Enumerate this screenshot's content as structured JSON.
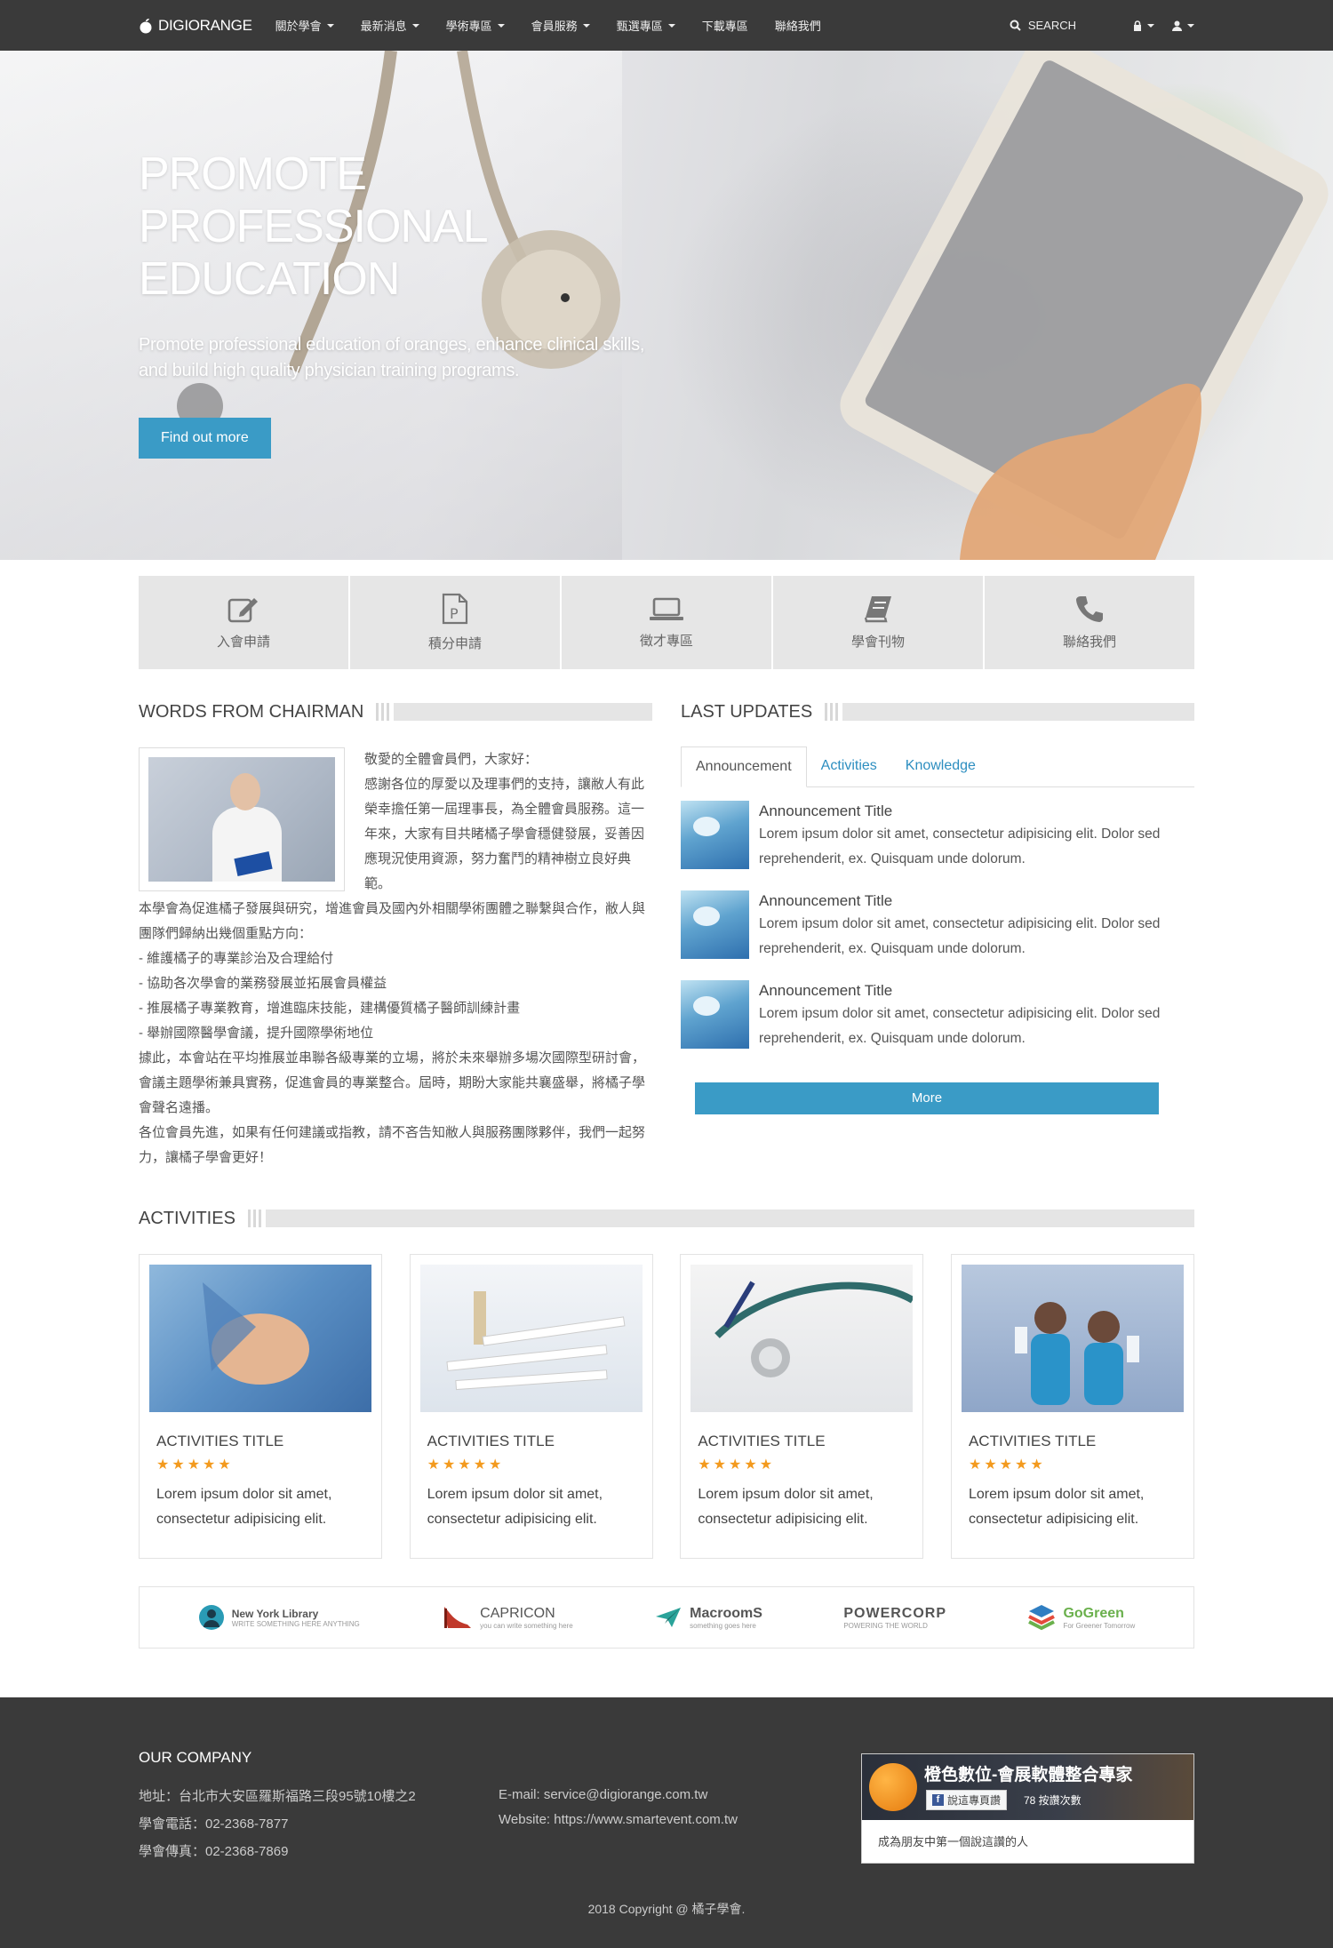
{
  "nav": {
    "brand": "DIGIORANGE",
    "items": [
      {
        "label": "關於學會",
        "dropdown": true
      },
      {
        "label": "最新消息",
        "dropdown": true
      },
      {
        "label": "學術專區",
        "dropdown": true
      },
      {
        "label": "會員服務",
        "dropdown": true
      },
      {
        "label": "甄選專區",
        "dropdown": true
      },
      {
        "label": "下載專區",
        "dropdown": false
      },
      {
        "label": "聯絡我們",
        "dropdown": false
      }
    ],
    "search": "SEARCH"
  },
  "hero": {
    "title_lines": [
      "PROMOTE",
      "PROFESSIONAL",
      "EDUCATION"
    ],
    "subtitle": "Promote professional education of oranges, enhance clinical skills, and build high quality physician training programs.",
    "button": "Find out more",
    "slide_count": 3,
    "active_slide": 2
  },
  "features": [
    {
      "label": "入會申請",
      "icon": "edit-icon"
    },
    {
      "label": "積分申請",
      "icon": "document-p-icon"
    },
    {
      "label": "徵才專區",
      "icon": "laptop-icon"
    },
    {
      "label": "學會刊物",
      "icon": "book-icon"
    },
    {
      "label": "聯絡我們",
      "icon": "phone-icon"
    }
  ],
  "chairman": {
    "heading": "WORDS FROM CHAIRMAN",
    "paragraphs": [
      "敬愛的全體會員們，大家好：",
      "感謝各位的厚愛以及理事們的支持，讓敝人有此榮幸擔任第一屆理事長，為全體會員服務。這一年來，大家有目共睹橘子學會穩健發展，妥善因應現況使用資源，努力奮鬥的精神樹立良好典範。",
      "本學會為促進橘子發展與研究，增進會員及國內外相關學術團體之聯繫與合作，敝人與團隊們歸納出幾個重點方向：",
      "- 維護橘子的專業診治及合理給付",
      "- 協助各次學會的業務發展並拓展會員權益",
      "- 推展橘子專業教育，增進臨床技能，建構優質橘子醫師訓練計畫",
      "- 舉辦國際醫學會議，提升國際學術地位",
      "據此，本會站在平均推展並串聯各級專業的立場，將於未來舉辦多場次國際型研討會，會議主題學術兼具實務，促進會員的專業整合。屆時，期盼大家能共襄盛舉，將橘子學會聲名遠播。",
      "各位會員先進，如果有任何建議或指教，請不吝告知敝人與服務團隊夥伴，我們一起努力，讓橘子學會更好！"
    ]
  },
  "updates": {
    "heading": "LAST UPDATES",
    "tabs": [
      "Announcement",
      "Activities",
      "Knowledge"
    ],
    "active_tab": 0,
    "items": [
      {
        "title": "Announcement Title",
        "text": "Lorem ipsum dolor sit amet, consectetur adipisicing elit. Dolor sed reprehenderit, ex. Quisquam unde dolorum."
      },
      {
        "title": "Announcement Title",
        "text": "Lorem ipsum dolor sit amet, consectetur adipisicing elit. Dolor sed reprehenderit, ex. Quisquam unde dolorum."
      },
      {
        "title": "Announcement Title",
        "text": "Lorem ipsum dolor sit amet, consectetur adipisicing elit. Dolor sed reprehenderit, ex. Quisquam unde dolorum."
      }
    ],
    "more": "More"
  },
  "activities": {
    "heading": "ACTIVITIES",
    "cards": [
      {
        "title": "ACTIVITIES TITLE",
        "rating": 5,
        "text": "Lorem ipsum dolor sit amet, consectetur adipisicing elit."
      },
      {
        "title": "ACTIVITIES TITLE",
        "rating": 5,
        "text": "Lorem ipsum dolor sit amet, consectetur adipisicing elit."
      },
      {
        "title": "ACTIVITIES TITLE",
        "rating": 5,
        "text": "Lorem ipsum dolor sit amet, consectetur adipisicing elit."
      },
      {
        "title": "ACTIVITIES TITLE",
        "rating": 5,
        "text": "Lorem ipsum dolor sit amet, consectetur adipisicing elit."
      }
    ]
  },
  "sponsors": [
    {
      "name": "New York Library",
      "tag": "WRITE SOMETHING HERE ANYTHING",
      "color": "#2a9bb5"
    },
    {
      "name": "CAPRICON",
      "tag": "you can write something here",
      "color": "#c0392b"
    },
    {
      "name": "MacroomS",
      "tag": "something goes here",
      "color": "#2aa39a"
    },
    {
      "name": "POWERCORP",
      "tag": "POWERING THE WORLD",
      "color": "#333333"
    },
    {
      "name": "GoGreen",
      "tag": "For Greener Tomorrow",
      "color": "#6ab04c"
    }
  ],
  "footer": {
    "company_heading": "OUR COMPANY",
    "address": "地址：台北市大安區羅斯福路三段95號10樓之2",
    "phone": "學會電話：02-2368-7877",
    "fax": "學會傳真：02-2368-7869",
    "email": "E-mail: service@digiorange.com.tw",
    "website": "Website: https://www.smartevent.com.tw",
    "fb": {
      "page_name": "橙色數位-會展軟體整合專家",
      "like_label": "說這專頁讚",
      "like_count": "78 按讚次數",
      "friend_text": "成為朋友中第一個說這讚的人"
    },
    "copyright": "2018 Copyright @ 橘子學會."
  },
  "colors": {
    "accent": "#3a9bc6",
    "nav_bg": "#3a3a3a",
    "star": "#f39a1e",
    "link": "#2d8ec0"
  }
}
